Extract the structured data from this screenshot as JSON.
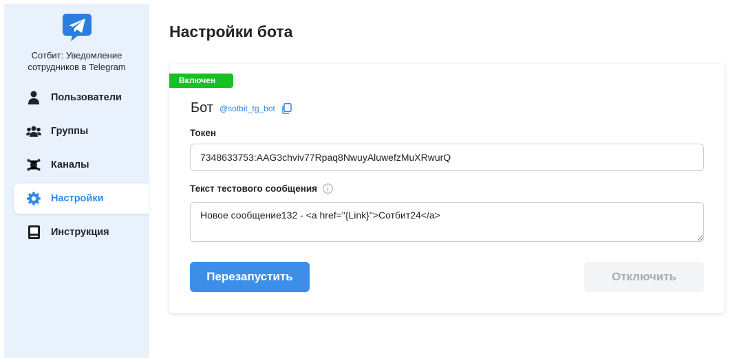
{
  "sidebar": {
    "brand_title": "Сотбит: Уведомление сотрудников в Telegram",
    "items": [
      {
        "label": "Пользователи",
        "icon": "user-icon",
        "active": false
      },
      {
        "label": "Группы",
        "icon": "users-group-icon",
        "active": false
      },
      {
        "label": "Каналы",
        "icon": "channels-icon",
        "active": false
      },
      {
        "label": "Настройки",
        "icon": "gear-icon",
        "active": true
      },
      {
        "label": "Инструкция",
        "icon": "book-icon",
        "active": false
      }
    ]
  },
  "page": {
    "title": "Настройки бота"
  },
  "card": {
    "status": "Включен",
    "bot_title": "Бот",
    "bot_handle": "@sotbit_tg_bot",
    "token_label": "Токен",
    "token_value": "7348633753:AAG3chviv77Rpaq8NwuyAluwefzMuXRwurQ",
    "message_label": "Текст тестового сообщения",
    "message_value": "Новое сообщение132 - <a href=\"{Link}\">Сотбит24</a>",
    "restart_label": "Перезапустить",
    "disable_label": "Отключить"
  },
  "colors": {
    "accent": "#3489e8",
    "status_green": "#17c124",
    "sidebar_bg": "#e8f1fc"
  }
}
